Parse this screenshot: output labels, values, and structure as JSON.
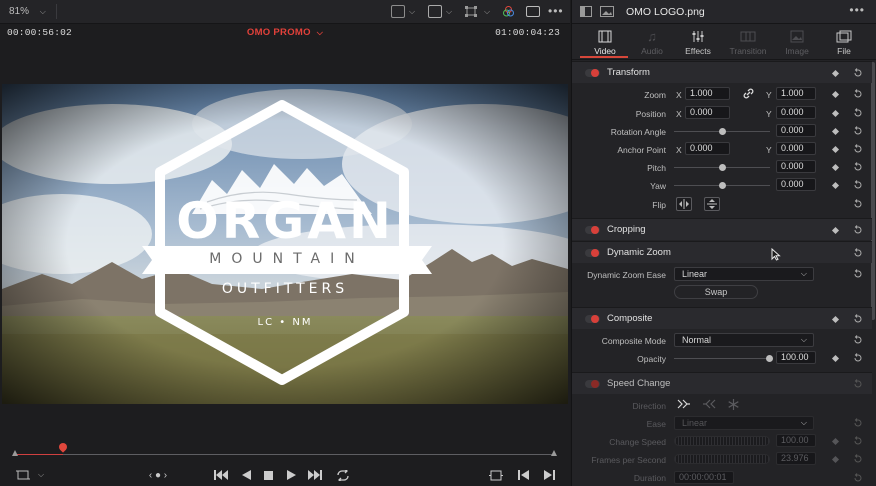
{
  "viewer": {
    "zoom": "81%",
    "timecode_left": "00:00:56:02",
    "timeline_name": "OMO PROMO",
    "timecode_right": "01:00:04:23",
    "logo_text": {
      "main": "ORGAN",
      "sub": "MOUNTAIN",
      "brand": "OUTFITTERS",
      "place": "LC • NM"
    },
    "playhead_progress": 0.09,
    "colors": {
      "accent_red": "#e2413a"
    }
  },
  "inspector": {
    "clip_name": "OMO LOGO.png",
    "tabs": [
      {
        "label": "Video",
        "icon": "film-icon",
        "state": "active"
      },
      {
        "label": "Audio",
        "icon": "music-note-icon",
        "state": "dim"
      },
      {
        "label": "Effects",
        "icon": "sliders-icon",
        "state": "normal"
      },
      {
        "label": "Transition",
        "icon": "transition-icon",
        "state": "dim"
      },
      {
        "label": "Image",
        "icon": "image-icon",
        "state": "dim"
      },
      {
        "label": "File",
        "icon": "file-icon",
        "state": "normal"
      }
    ],
    "transform": {
      "title": "Transform",
      "zoom_label": "Zoom",
      "zoom_x": "1.000",
      "zoom_y": "1.000",
      "position_label": "Position",
      "position_x": "0.000",
      "position_y": "0.000",
      "rotation_label": "Rotation Angle",
      "rotation": "0.000",
      "anchor_label": "Anchor Point",
      "anchor_x": "0.000",
      "anchor_y": "0.000",
      "pitch_label": "Pitch",
      "pitch": "0.000",
      "yaw_label": "Yaw",
      "yaw": "0.000",
      "flip_label": "Flip",
      "x_label": "X",
      "y_label": "Y"
    },
    "cropping": {
      "title": "Cropping"
    },
    "dynamic_zoom": {
      "title": "Dynamic Zoom",
      "ease_label": "Dynamic Zoom Ease",
      "ease_value": "Linear",
      "swap_label": "Swap"
    },
    "composite": {
      "title": "Composite",
      "mode_label": "Composite Mode",
      "mode_value": "Normal",
      "opacity_label": "Opacity",
      "opacity_value": "100.00"
    },
    "speed_change": {
      "title": "Speed Change",
      "direction_label": "Direction",
      "ease_label": "Ease",
      "ease_value": "Linear",
      "change_speed_label": "Change Speed",
      "change_speed_value": "100.00",
      "fps_label": "Frames per Second",
      "fps_value": "23.976",
      "duration_label": "Duration",
      "duration_value": "00:00:00:01"
    }
  }
}
